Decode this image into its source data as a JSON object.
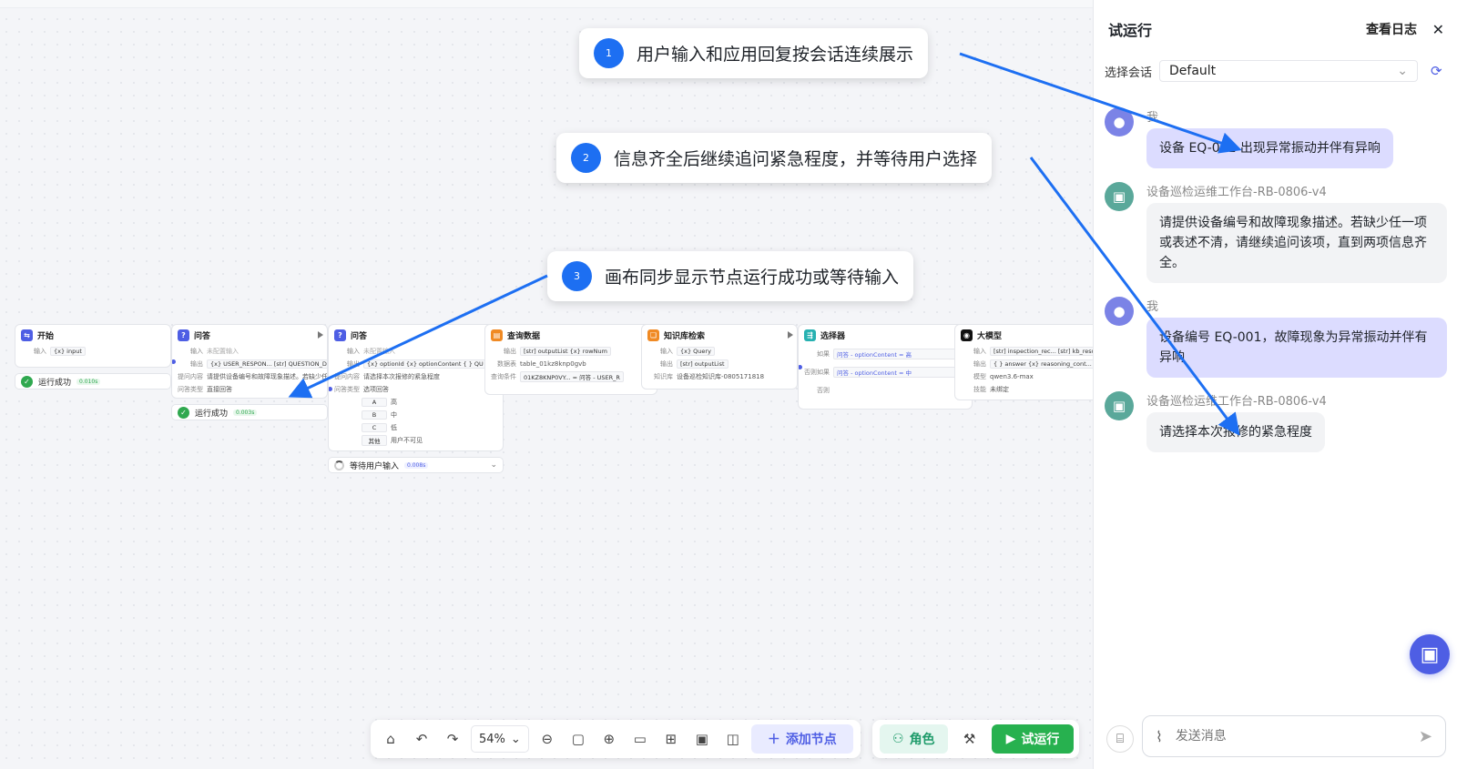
{
  "canvas": {
    "nodes": [
      {
        "title": "开始",
        "icon_color": "#4e5ee4",
        "rows": [
          {
            "k": "输入",
            "v": "{x} input"
          }
        ]
      },
      {
        "title": "问答",
        "icon_color": "#4e5ee4",
        "rows": [
          {
            "k": "输入",
            "v": "未配置输入"
          },
          {
            "k": "输出",
            "v": "{x} USER_RESPON...  [str] QUESTION_DAT"
          },
          {
            "k": "提问内容",
            "v": "请提供设备编号和故障现象描述。若缺少任一项"
          },
          {
            "k": "问答类型",
            "v": "直接回答"
          }
        ]
      },
      {
        "title": "问答",
        "icon_color": "#4e5ee4",
        "rows": [
          {
            "k": "输入",
            "v": "未配置输入"
          },
          {
            "k": "输出",
            "v": "{x} optionId  {x} optionContent  { } QU"
          },
          {
            "k": "提问内容",
            "v": "请选择本次报修的紧急程度"
          },
          {
            "k": "问答类型",
            "v": "选项回答"
          }
        ],
        "options": [
          {
            "key": "A",
            "val": "高"
          },
          {
            "key": "B",
            "val": "中"
          },
          {
            "key": "C",
            "val": "低"
          },
          {
            "key": "其他",
            "val": "用户不可见"
          }
        ]
      },
      {
        "title": "查询数据",
        "icon_color": "#f08a24",
        "rows": [
          {
            "k": "输出",
            "v": "[str] outputList  {x} rowNum"
          },
          {
            "k": "数据表",
            "v": "table_01kz8knp0gvb"
          },
          {
            "k": "查询条件",
            "v": "01KZ8KNP0VY...  =  问答 - USER_R"
          }
        ]
      },
      {
        "title": "知识库检索",
        "icon_color": "#f08a24",
        "rows": [
          {
            "k": "输入",
            "v": "{x} Query"
          },
          {
            "k": "输出",
            "v": "[str] outputList"
          },
          {
            "k": "知识库",
            "v": "设备巡检知识库-0805171818"
          }
        ]
      },
      {
        "title": "选择器",
        "icon_color": "#27b1b1",
        "rows": [
          {
            "k": "如果",
            "v": "问答 - optionContent  =  高"
          },
          {
            "k": "否则如果",
            "v": "问答 - optionContent  =  中"
          },
          {
            "k": "否则",
            "v": ""
          }
        ]
      },
      {
        "title": "大模型",
        "icon_color": "#111111",
        "rows": [
          {
            "k": "输入",
            "v": "[str] inspection_rec...  [str] kb_results"
          },
          {
            "k": "输出",
            "v": "{ } answer  {x} reasoning_cont..."
          },
          {
            "k": "模型",
            "v": "qwen3.6-max"
          },
          {
            "k": "技能",
            "v": "未绑定"
          }
        ]
      }
    ],
    "status1": {
      "text": "运行成功",
      "time": "0.010s"
    },
    "status2": {
      "text": "运行成功",
      "time": "0.003s"
    },
    "status3": {
      "text": "等待用户输入",
      "time": "0.008s"
    }
  },
  "callouts": [
    {
      "num": "1",
      "text": "用户输入和应用回复按会话连续展示"
    },
    {
      "num": "2",
      "text": "信息齐全后继续追问紧急程度，并等待用户选择"
    },
    {
      "num": "3",
      "text": "画布同步显示节点运行成功或等待输入"
    }
  ],
  "toolbar": {
    "zoom": "54%",
    "add_node": "添加节点",
    "role": "角色",
    "run": "试运行"
  },
  "panel": {
    "title": "试运行",
    "view_log": "查看日志",
    "session_label": "选择会话",
    "session_value": "Default",
    "messages": [
      {
        "role": "user",
        "name": "我",
        "text": "设备 EQ-001 出现异常振动并伴有异响"
      },
      {
        "role": "bot",
        "name": "设备巡检运维工作台-RB-0806-v4",
        "text": "请提供设备编号和故障现象描述。若缺少任一项或表述不清，请继续追问该项，直到两项信息齐全。"
      },
      {
        "role": "user",
        "name": "我",
        "text": "设备编号 EQ-001，故障现象为异常振动并伴有异响"
      },
      {
        "role": "bot",
        "name": "设备巡检运维工作台-RB-0806-v4",
        "text": "请选择本次报修的紧急程度"
      }
    ],
    "input_placeholder": "发送消息"
  },
  "colors": {
    "accent": "#4e5ee4",
    "success": "#27b14f",
    "callout_number": "#1d6ff2",
    "arrow": "#1d6ff2"
  }
}
